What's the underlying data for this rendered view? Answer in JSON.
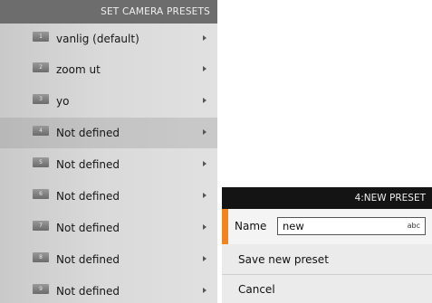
{
  "presets_panel": {
    "title": "SET CAMERA PRESETS",
    "items": [
      {
        "number": "1",
        "label": "vanlig (default)"
      },
      {
        "number": "2",
        "label": "zoom ut"
      },
      {
        "number": "3",
        "label": "yo"
      },
      {
        "number": "4",
        "label": "Not defined",
        "highlighted": true
      },
      {
        "number": "5",
        "label": "Not defined"
      },
      {
        "number": "6",
        "label": "Not defined"
      },
      {
        "number": "7",
        "label": "Not defined"
      },
      {
        "number": "8",
        "label": "Not defined"
      },
      {
        "number": "9",
        "label": "Not defined"
      }
    ]
  },
  "dialog": {
    "title": "4:NEW PRESET",
    "name_label": "Name",
    "name_value": "new",
    "keyboard_mode": "abc",
    "save_label": "Save new preset",
    "cancel_label": "Cancel",
    "accent_color": "#f18321"
  },
  "icons": {
    "row_chevron": "chevron-right-icon",
    "preset_number": "preset-number-icon"
  }
}
